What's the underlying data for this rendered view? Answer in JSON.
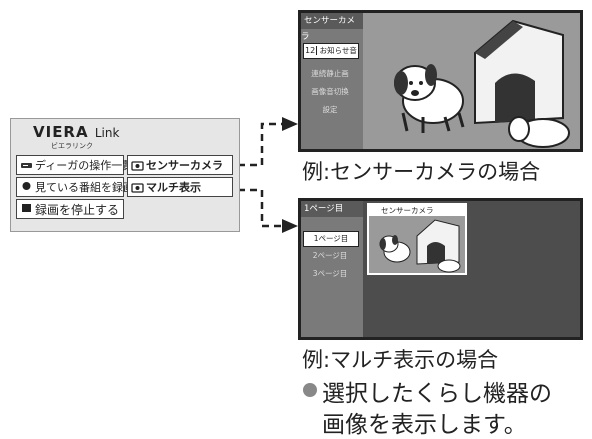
{
  "viera": {
    "logo": "VIERA",
    "logo_sub": "Link",
    "kana": "ビエラリンク",
    "buttons": {
      "diga": "ディーガの操作一覧",
      "sensor": "センサーカメラ",
      "record": "見ている番組を録画",
      "multi": "マルチ表示",
      "stop": "録画を停止する"
    },
    "rec_label": "REC",
    "stop_label": "STOP"
  },
  "sensor_screen": {
    "title": "センサーカメラ",
    "items": [
      {
        "num": "12",
        "label": "お知らせ音"
      },
      {
        "label": "連続静止画"
      },
      {
        "label": "画像音切換"
      },
      {
        "label": "設定"
      }
    ]
  },
  "multi_screen": {
    "title": "1ページ目",
    "pages": [
      "1ページ目",
      "2ページ目",
      "3ページ目"
    ],
    "thumb_title": "センサーカメラ"
  },
  "captions": {
    "sensor_example": "例:センサーカメラの場合",
    "multi_example": "例:マルチ表示の場合"
  },
  "notes": {
    "line1": "選択したくらし機器の",
    "line2": "画像を表示します。"
  },
  "colors": {
    "screen_bg": "#4d4d4d",
    "sidebar_bg": "#7a7a7a",
    "panel_bg": "#e6e6e6"
  }
}
